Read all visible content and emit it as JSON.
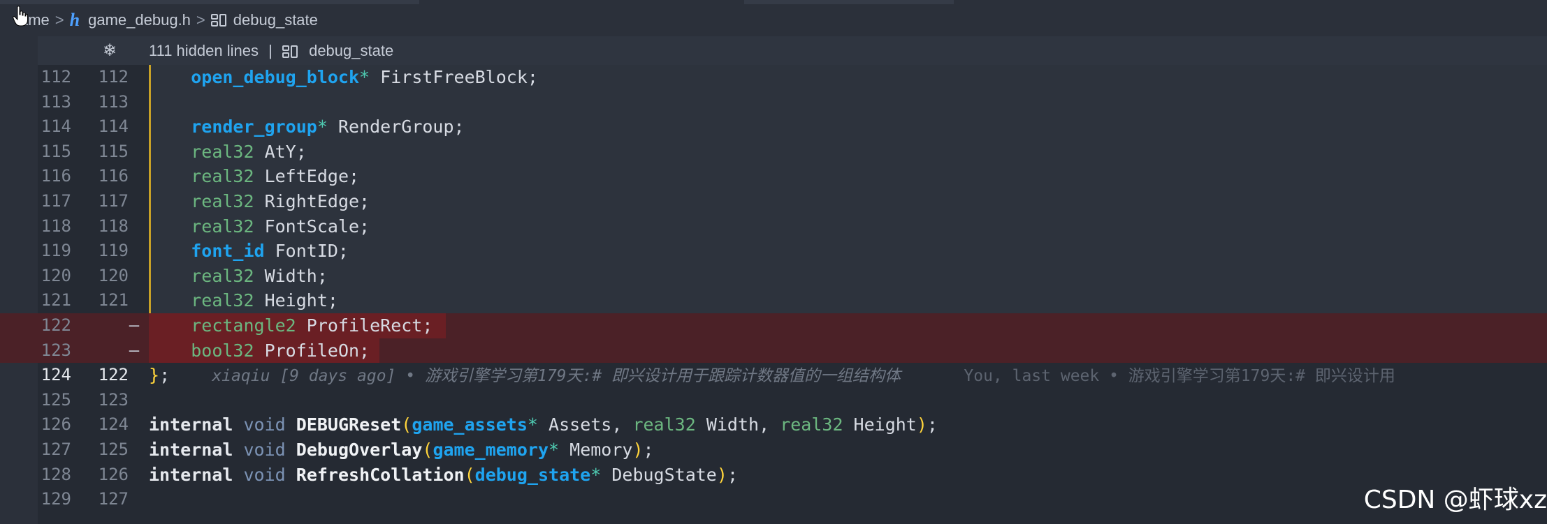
{
  "breadcrumb": {
    "items": [
      {
        "label": "ame",
        "icon": "folder-icon"
      },
      {
        "label": "game_debug.h",
        "icon": "header-file-icon"
      },
      {
        "label": "debug_state",
        "icon": "struct-icon"
      }
    ],
    "header_glyph": "h",
    "separator": ">"
  },
  "fold": {
    "text": "111 hidden lines",
    "divider": "|",
    "symbol": "debug_state",
    "icon": "fold-unfold-icon"
  },
  "lines": [
    {
      "left": "112",
      "right": "112",
      "code": "    open_debug_block* FirstFreeBlock;"
    },
    {
      "left": "113",
      "right": "113",
      "code": ""
    },
    {
      "left": "114",
      "right": "114",
      "code": "    render_group* RenderGroup;"
    },
    {
      "left": "115",
      "right": "115",
      "code": "    real32 AtY;"
    },
    {
      "left": "116",
      "right": "116",
      "code": "    real32 LeftEdge;"
    },
    {
      "left": "117",
      "right": "117",
      "code": "    real32 RightEdge;"
    },
    {
      "left": "118",
      "right": "118",
      "code": "    real32 FontScale;"
    },
    {
      "left": "119",
      "right": "119",
      "code": "    font_id FontID;"
    },
    {
      "left": "120",
      "right": "120",
      "code": "    real32 Width;"
    },
    {
      "left": "121",
      "right": "121",
      "code": "    real32 Height;"
    },
    {
      "left": "122",
      "right": "—",
      "code": "    rectangle2 ProfileRect;"
    },
    {
      "left": "123",
      "right": "—",
      "code": "    bool32 ProfileOn;"
    },
    {
      "left": "124",
      "right": "122",
      "code": "};"
    },
    {
      "left": "125",
      "right": "123",
      "code": ""
    },
    {
      "left": "126",
      "right": "124",
      "code": "internal void DEBUGReset(game_assets* Assets, real32 Width, real32 Height);"
    },
    {
      "left": "127",
      "right": "125",
      "code": "internal void DebugOverlay(game_memory* Memory);"
    },
    {
      "left": "128",
      "right": "126",
      "code": "internal void RefreshCollation(debug_state* DebugState);"
    },
    {
      "left": "129",
      "right": "127",
      "code": ""
    }
  ],
  "blame": {
    "author_text": "xiaqiu [9 days ago] • 游戏引擎学习第179天:# 即兴设计用于跟踪计数器值的一组结构体",
    "second_text": "You, last week • 游戏引擎学习第179天:# 即兴设计用"
  },
  "watermark": "CSDN @虾球xz",
  "colors": {
    "background": "#252a33",
    "deleted_line": "#4b2127",
    "deleted_text": "#6a1f24",
    "change_bar": "#c9a227",
    "type": "#1fa4f0",
    "builtin": "#6cb780"
  }
}
